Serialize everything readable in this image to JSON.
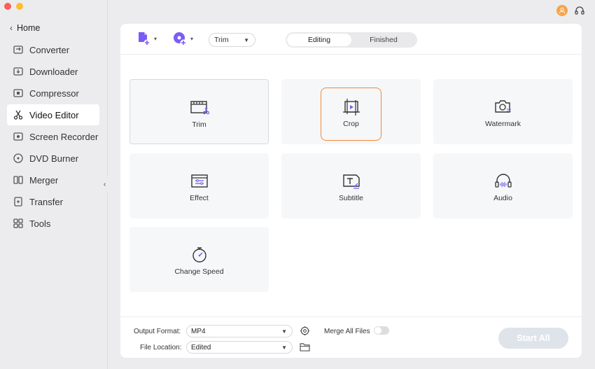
{
  "sidebar": {
    "home_label": "Home",
    "items": [
      {
        "label": "Converter",
        "icon": "converter-icon"
      },
      {
        "label": "Downloader",
        "icon": "downloader-icon"
      },
      {
        "label": "Compressor",
        "icon": "compressor-icon"
      },
      {
        "label": "Video Editor",
        "icon": "video-editor-icon",
        "active": true
      },
      {
        "label": "Screen Recorder",
        "icon": "screen-recorder-icon"
      },
      {
        "label": "DVD Burner",
        "icon": "dvd-burner-icon"
      },
      {
        "label": "Merger",
        "icon": "merger-icon"
      },
      {
        "label": "Transfer",
        "icon": "transfer-icon"
      },
      {
        "label": "Tools",
        "icon": "tools-icon"
      }
    ]
  },
  "toolbar": {
    "trim_select": "Trim",
    "tabs": [
      "Editing",
      "Finished"
    ],
    "active_tab": "Editing"
  },
  "tools": [
    {
      "label": "Trim"
    },
    {
      "label": "Crop"
    },
    {
      "label": "Watermark"
    },
    {
      "label": "Effect"
    },
    {
      "label": "Subtitle"
    },
    {
      "label": "Audio"
    },
    {
      "label": "Change Speed"
    }
  ],
  "bottom": {
    "output_format_label": "Output Format:",
    "output_format_value": "MP4",
    "file_location_label": "File Location:",
    "file_location_value": "Edited",
    "merge_label": "Merge All Files",
    "start_all_label": "Start All"
  },
  "colors": {
    "accent": "#7b5cf5",
    "crop_highlight": "#f08a3c"
  }
}
